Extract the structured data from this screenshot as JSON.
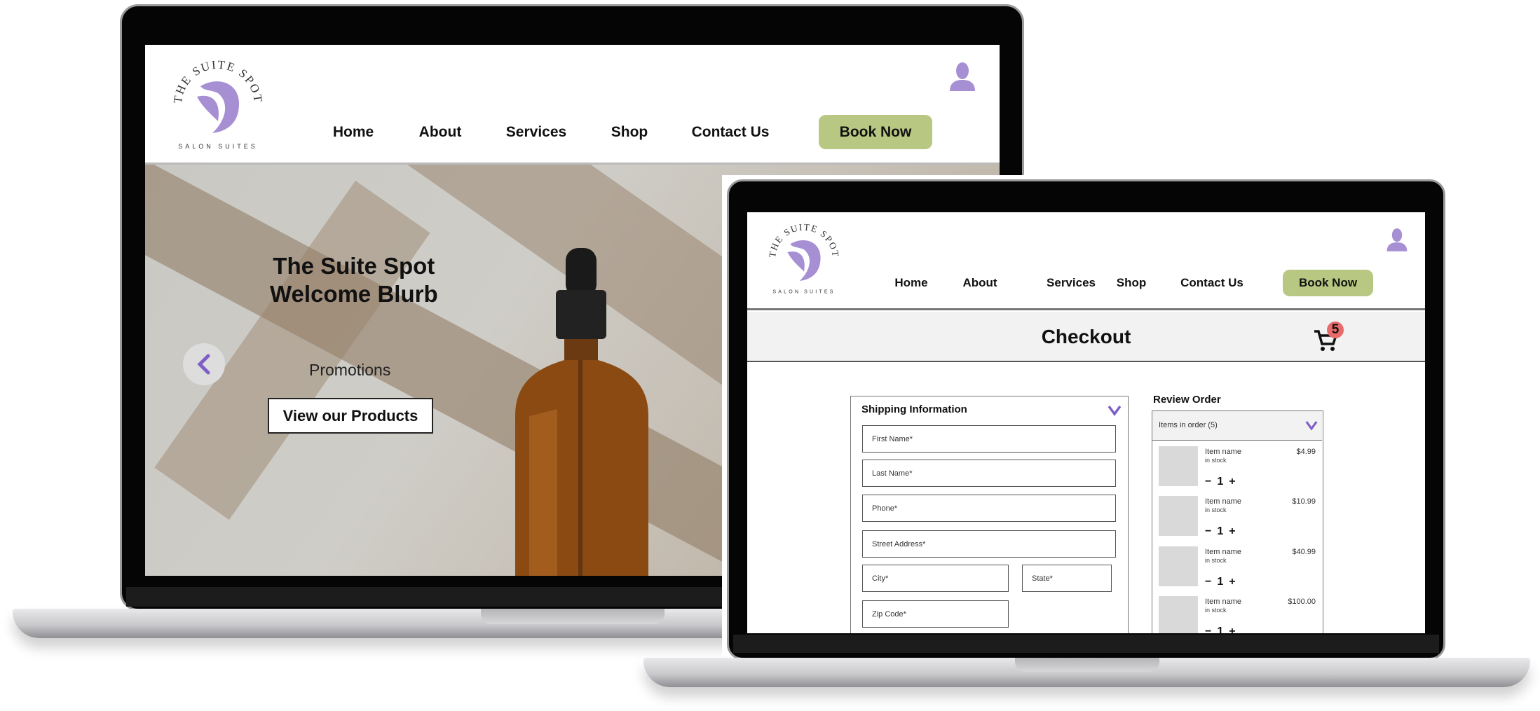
{
  "brand": {
    "logo_top": "THE SUITE SPOT",
    "logo_bottom": "SALON SUITES"
  },
  "colors": {
    "accent": "#a78fd4",
    "book_button": "#b8c882",
    "badge": "#e86a6a"
  },
  "nav": {
    "items": [
      "Home",
      "About",
      "Services",
      "Shop",
      "Contact Us"
    ],
    "book_label": "Book Now"
  },
  "home": {
    "hero_title_line1": "The Suite Spot",
    "hero_title_line2": "Welcome Blurb",
    "promotions": "Promotions",
    "cta": "View our Products"
  },
  "checkout": {
    "title": "Checkout",
    "cart_count": "5",
    "shipping": {
      "title": "Shipping Information",
      "fields": {
        "first_name": "First Name*",
        "last_name": "Last Name*",
        "phone": "Phone*",
        "street": "Street Address*",
        "city": "City*",
        "state": "State*",
        "zip": "Zip Code*"
      }
    },
    "review": {
      "title": "Review Order",
      "items_label": "Items in order (5)",
      "items": [
        {
          "name": "Item name",
          "stock": "in stock",
          "price": "$4.99",
          "qty": "1"
        },
        {
          "name": "Item name",
          "stock": "in stock",
          "price": "$10.99",
          "qty": "1"
        },
        {
          "name": "Item name",
          "stock": "in stock",
          "price": "$40.99",
          "qty": "1"
        },
        {
          "name": "Item name",
          "stock": "in stock",
          "price": "$100.00",
          "qty": "1"
        }
      ],
      "minus": "−",
      "plus": "+"
    }
  }
}
